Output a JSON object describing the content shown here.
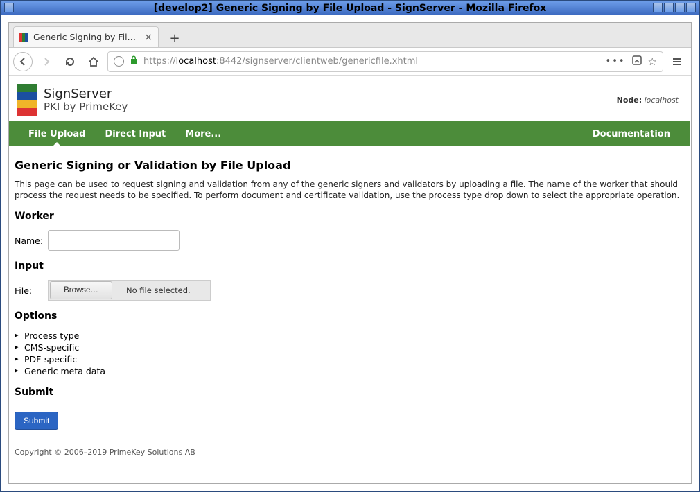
{
  "window": {
    "title": "[develop2] Generic Signing by File Upload - SignServer - Mozilla Firefox"
  },
  "tab": {
    "title": "Generic Signing by File U…"
  },
  "url": {
    "scheme": "https://",
    "host": "localhost",
    "port_path": ":8442/signserver/clientweb/genericfile.xhtml"
  },
  "logo": {
    "line1": "SignServer",
    "line2": "PKI by PrimeKey"
  },
  "node": {
    "label": "Node:",
    "value": "localhost"
  },
  "nav": {
    "items": [
      {
        "label": "File Upload",
        "active": true
      },
      {
        "label": "Direct Input",
        "active": false
      },
      {
        "label": "More...",
        "active": false
      }
    ],
    "right": "Documentation"
  },
  "page": {
    "title": "Generic Signing or Validation by File Upload",
    "intro": "This page can be used to request signing and validation from any of the generic signers and validators by uploading a file. The name of the worker that should process the request needs to be specified. To perform document and certificate validation, use the process type drop down to select the appropriate operation."
  },
  "sections": {
    "worker": {
      "heading": "Worker",
      "name_label": "Name:",
      "name_value": ""
    },
    "input": {
      "heading": "Input",
      "file_label": "File:",
      "browse": "Browse…",
      "no_file": "No file selected."
    },
    "options": {
      "heading": "Options",
      "items": [
        "Process type",
        "CMS-specific",
        "PDF-specific",
        "Generic meta data"
      ]
    },
    "submit": {
      "heading": "Submit",
      "button": "Submit"
    }
  },
  "footer": "Copyright © 2006–2019 PrimeKey Solutions AB"
}
